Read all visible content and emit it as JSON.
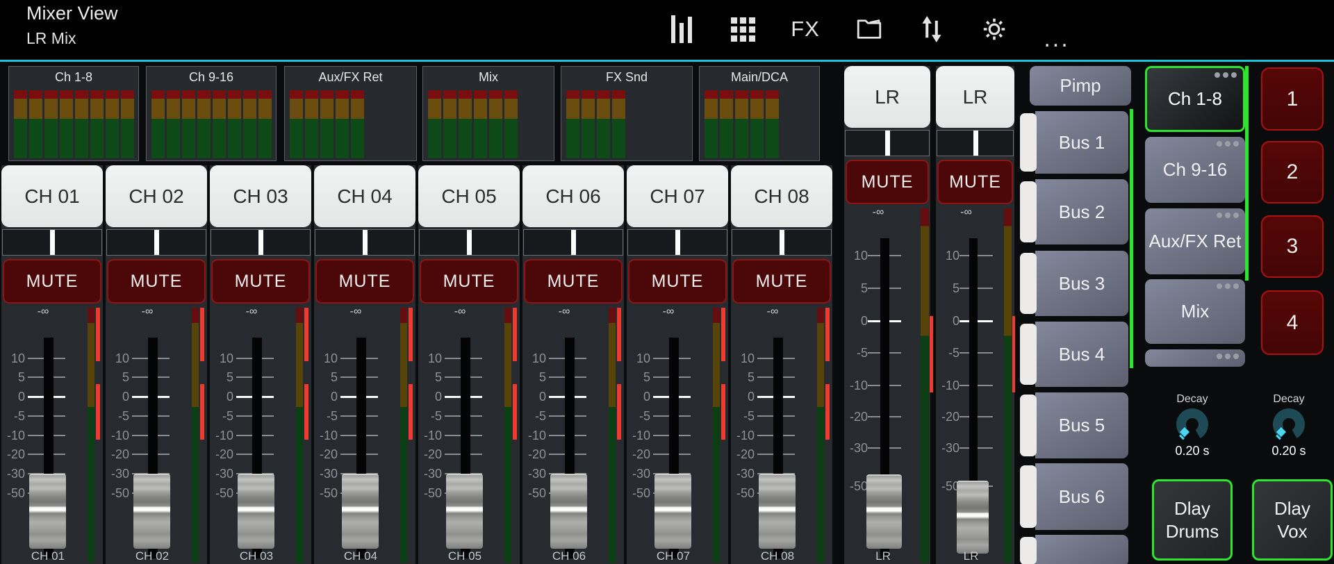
{
  "topbar": {
    "title": "Mixer View",
    "subtitle": "LR Mix",
    "fx_label": "FX",
    "more_label": "...",
    "icons": [
      "meters-view",
      "channel-grid",
      "fx",
      "scenes-folder",
      "sort",
      "settings",
      "more"
    ]
  },
  "labels": {
    "mute": "MUTE"
  },
  "meter_bridge": [
    {
      "label": "Ch 1-8",
      "meters": 8
    },
    {
      "label": "Ch 9-16",
      "meters": 8
    },
    {
      "label": "Aux/FX Ret",
      "meters": 5
    },
    {
      "label": "Mix",
      "meters": 6
    },
    {
      "label": "FX Snd",
      "meters": 4
    },
    {
      "label": "Main/DCA",
      "meters": 5
    }
  ],
  "fader_scale": [
    "10",
    "5",
    "0",
    "-5",
    "-10",
    "-20",
    "-30",
    "-50"
  ],
  "channels": [
    {
      "name": "CH 01",
      "level": "-∞",
      "bottom_label": "CH 01"
    },
    {
      "name": "CH 02",
      "level": "-∞",
      "bottom_label": "CH 02"
    },
    {
      "name": "CH 03",
      "level": "-∞",
      "bottom_label": "CH 03"
    },
    {
      "name": "CH 04",
      "level": "-∞",
      "bottom_label": "CH 04"
    },
    {
      "name": "CH 05",
      "level": "-∞",
      "bottom_label": "CH 05"
    },
    {
      "name": "CH 06",
      "level": "-∞",
      "bottom_label": "CH 06"
    },
    {
      "name": "CH 07",
      "level": "-∞",
      "bottom_label": "CH 07"
    },
    {
      "name": "CH 08",
      "level": "-∞",
      "bottom_label": "CH 08"
    }
  ],
  "mains": [
    {
      "name": "LR",
      "level": "-∞",
      "bottom_label": "LR"
    },
    {
      "name": "LR",
      "level": "-∞",
      "bottom_label": "LR"
    }
  ],
  "bus_column": {
    "items": [
      "Pimp",
      "Bus 1",
      "Bus 2",
      "Bus 3",
      "Bus 4",
      "Bus 5",
      "Bus 6"
    ]
  },
  "layer_column": {
    "items": [
      {
        "label": "Ch 1-8",
        "selected": true
      },
      {
        "label": "Ch 9-16",
        "selected": false
      },
      {
        "label": "Aux/FX Ret",
        "selected": false
      },
      {
        "label": "Mix",
        "selected": false
      }
    ]
  },
  "bank_buttons": [
    "1",
    "2",
    "3",
    "4"
  ],
  "fx_controls": [
    {
      "label": "Decay",
      "value": "0.20 s"
    },
    {
      "label": "Decay",
      "value": "0.20 s"
    }
  ],
  "fx_buttons": [
    "Dlay Drums",
    "Dlay Vox"
  ],
  "colors": {
    "accent_green": "#2de52d",
    "accent_cyan": "#17c3da",
    "knob_cyan": "#49d6ee",
    "mute_red": "#4c0808",
    "bank_red": "#560707",
    "meter_red": "#7a0e0e",
    "meter_amber": "#6a4d0f",
    "meter_green": "#0d4a17",
    "gr_bright_red": "#ef3a30",
    "slate_button": "#6a6d7f"
  }
}
